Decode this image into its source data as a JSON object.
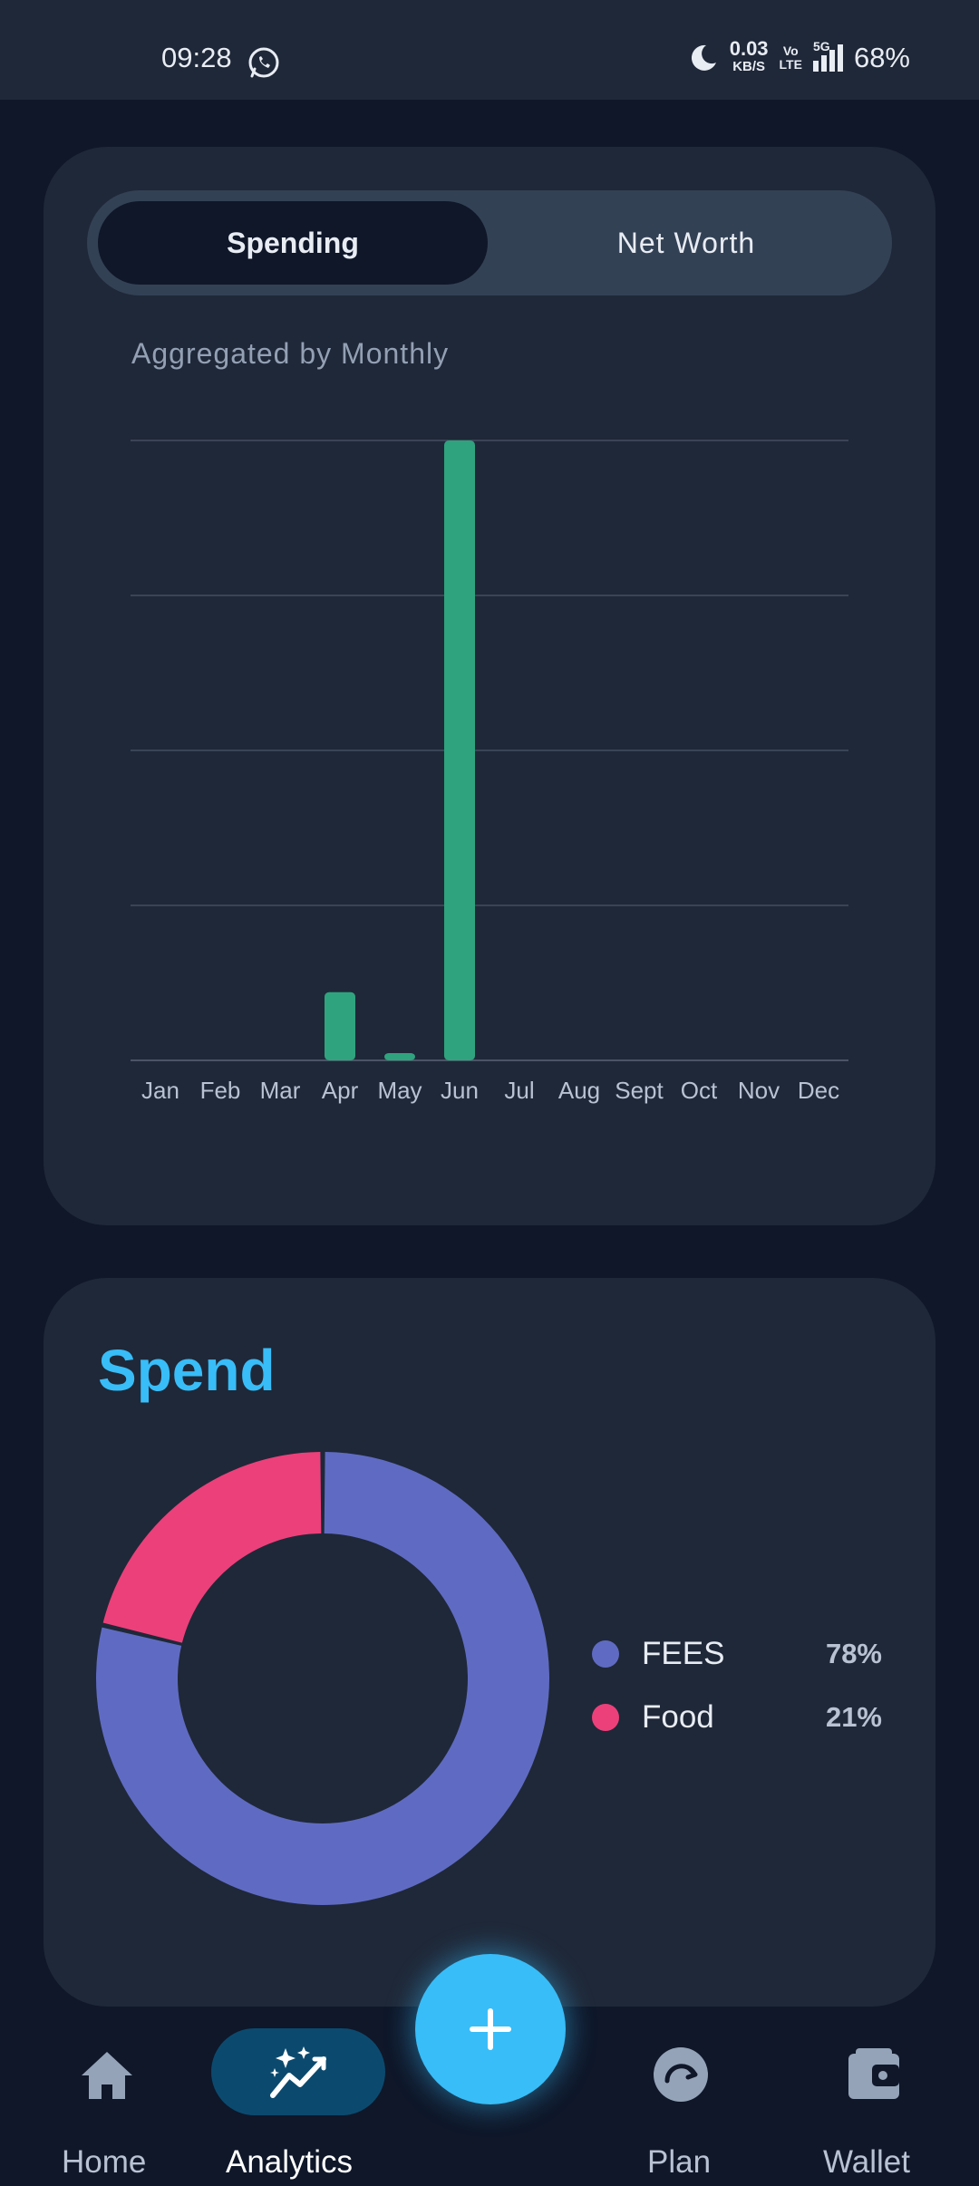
{
  "status_bar": {
    "time": "09:28",
    "net_speed": "0.03",
    "net_unit": "KB/S",
    "volte_top": "Vo",
    "volte_bottom": "LTE",
    "network": "5G",
    "battery": "68%"
  },
  "toggle": {
    "active_label": "Spending",
    "inactive_label": "Net Worth"
  },
  "chart_section": {
    "subtitle": "Aggregated by Monthly"
  },
  "chart_data": [
    {
      "type": "bar",
      "categories": [
        "Jan",
        "Feb",
        "Mar",
        "Apr",
        "May",
        "Jun",
        "Jul",
        "Aug",
        "Sept",
        "Oct",
        "Nov",
        "Dec"
      ],
      "values": [
        0,
        0,
        0,
        11,
        1,
        100,
        0,
        0,
        0,
        0,
        0,
        0
      ],
      "ylim": [
        0,
        100
      ],
      "grid": true,
      "bar_color": "#2fa37e"
    },
    {
      "type": "pie",
      "donut": true,
      "categories": [
        "FEES",
        "Food"
      ],
      "values": [
        78,
        21
      ],
      "colors": [
        "#5f6bc2",
        "#ec407a"
      ]
    }
  ],
  "spend_card": {
    "title": "Spend",
    "legend": [
      {
        "name": "FEES",
        "pct": "78%",
        "color": "#5f6bc2"
      },
      {
        "name": "Food",
        "pct": "21%",
        "color": "#ec407a"
      }
    ]
  },
  "bottom_nav": {
    "items": [
      {
        "label": "Home",
        "icon": "home-icon"
      },
      {
        "label": "Analytics",
        "icon": "analytics-icon"
      },
      {
        "label": "Plan",
        "icon": "plan-icon"
      },
      {
        "label": "Wallet",
        "icon": "wallet-icon"
      }
    ],
    "active": "Analytics",
    "fab_icon": "plus-icon"
  },
  "colors": {
    "background": "#0f1729",
    "card": "#1f2838",
    "accent": "#38bdf8",
    "bar": "#2fa37e"
  }
}
